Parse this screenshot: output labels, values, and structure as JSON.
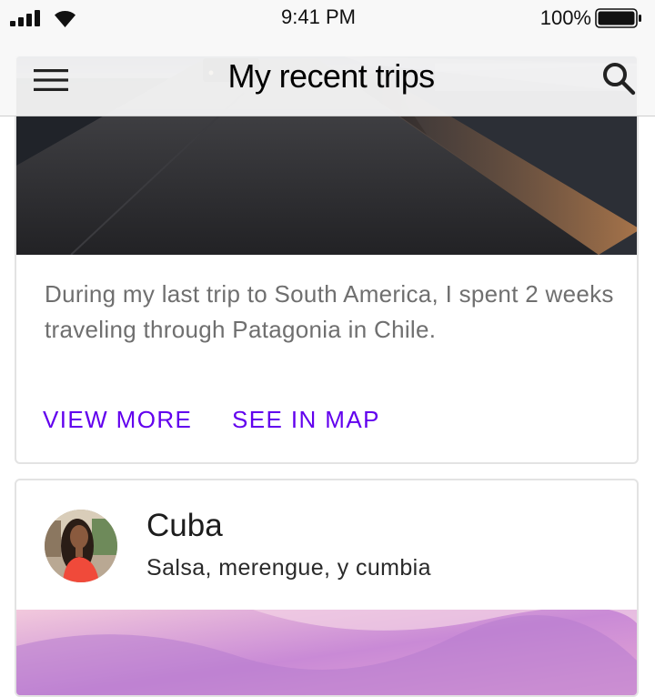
{
  "status_bar": {
    "time": "9:41 PM",
    "battery_percent": "100%",
    "icons": [
      "signal-icon",
      "wifi-icon",
      "battery-icon"
    ]
  },
  "app_bar": {
    "title": "My recent trips",
    "left_icon": "menu-icon",
    "right_icon": "search-icon"
  },
  "cards": [
    {
      "image": "road-at-dusk-photo",
      "description": "During my last trip to South America, I spent 2 weeks traveling through Patagonia in Chile.",
      "actions": [
        "VIEW MORE",
        "SEE IN MAP"
      ]
    },
    {
      "title": "Cuba",
      "subtitle": "Salsa, merengue, y cumbia",
      "avatar": "user-avatar-photo",
      "image": "pink-abstract-photo"
    }
  ],
  "colors": {
    "accent": "#6200ee",
    "description_text": "#6f6f6f",
    "card_border": "#e3e3e3",
    "app_bar_background": "#f8f8f8"
  }
}
